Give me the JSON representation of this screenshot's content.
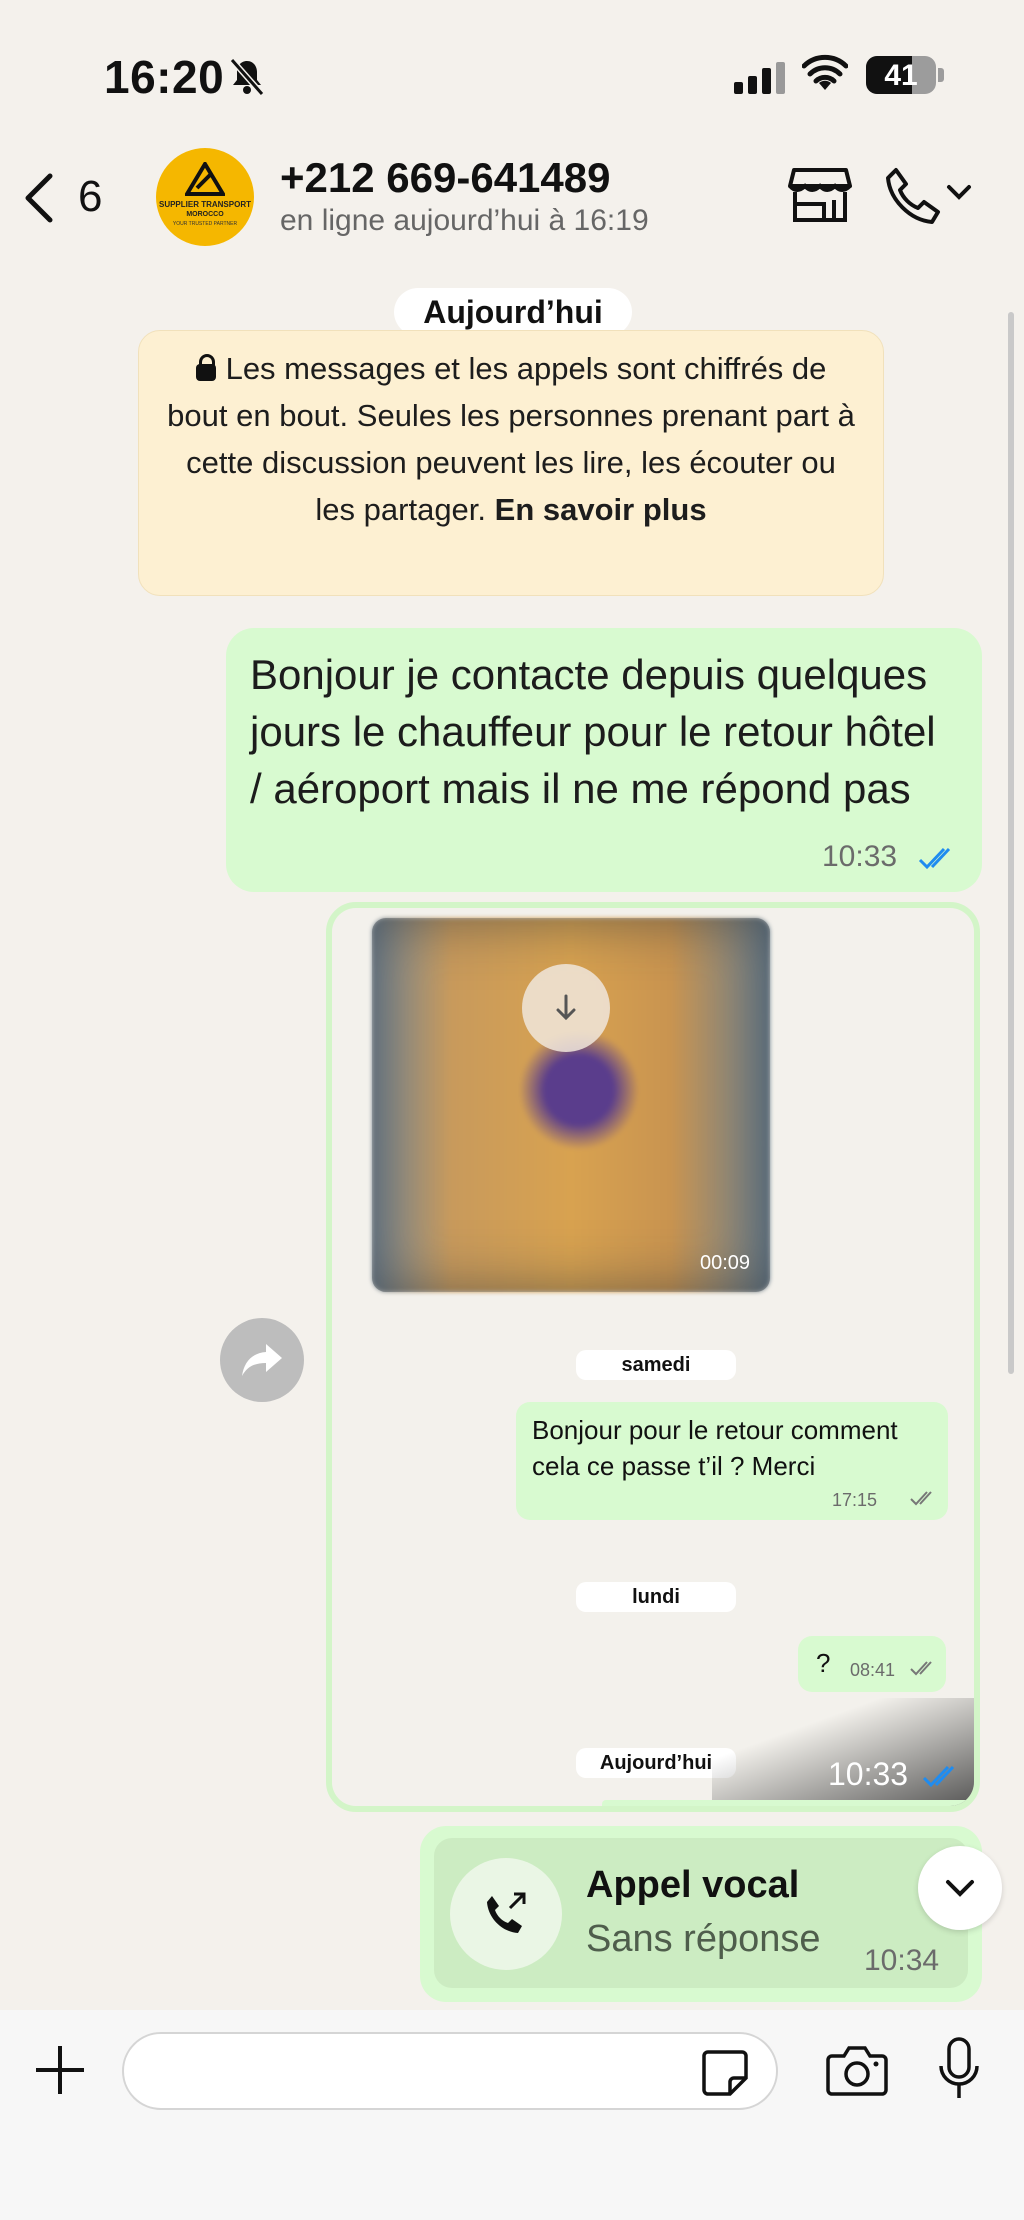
{
  "status_bar": {
    "time": "16:20",
    "battery": "41"
  },
  "header": {
    "back_count": "6",
    "contact_name": "+212 669-641489",
    "contact_status": "en ligne aujourd’hui à 16:19",
    "avatar_logo": {
      "line1": "SUPPLIER TRANSPORT",
      "line2": "MOROCCO",
      "line3": "YOUR TRUSTED PARTNER"
    }
  },
  "chat": {
    "date_top": "Aujourd’hui",
    "encryption": {
      "text": "Les messages et les appels sont chiffrés de bout en bout. Seules les personnes prenant part à cette discussion peuvent les lire, les écouter ou les partager.",
      "link": "En savoir plus"
    },
    "message1": {
      "text": "Bonjour je contacte depuis quelques jours le chauffeur pour le retour hôtel / aéroport mais il ne me répond pas",
      "time": "10:33"
    },
    "screenshot": {
      "video_duration": "00:09",
      "date_samedi": "samedi",
      "msg_retour": {
        "text": "Bonjour pour le retour comment cela ce passe t’il ? Merci",
        "time": "17:15"
      },
      "date_lundi": "lundi",
      "msg_q": {
        "text": "?",
        "time": "08:41"
      },
      "date_today": "Aujourd’hui",
      "time": "10:33"
    },
    "call": {
      "title": "Appel vocal",
      "subtitle": "Sans réponse",
      "time": "10:34"
    }
  },
  "colors": {
    "outgoing_bubble": "#d8fad0",
    "background": "#f4f1ec",
    "read_ticks": "#1f8cf0",
    "encryption_bg": "#fdf0d2"
  }
}
